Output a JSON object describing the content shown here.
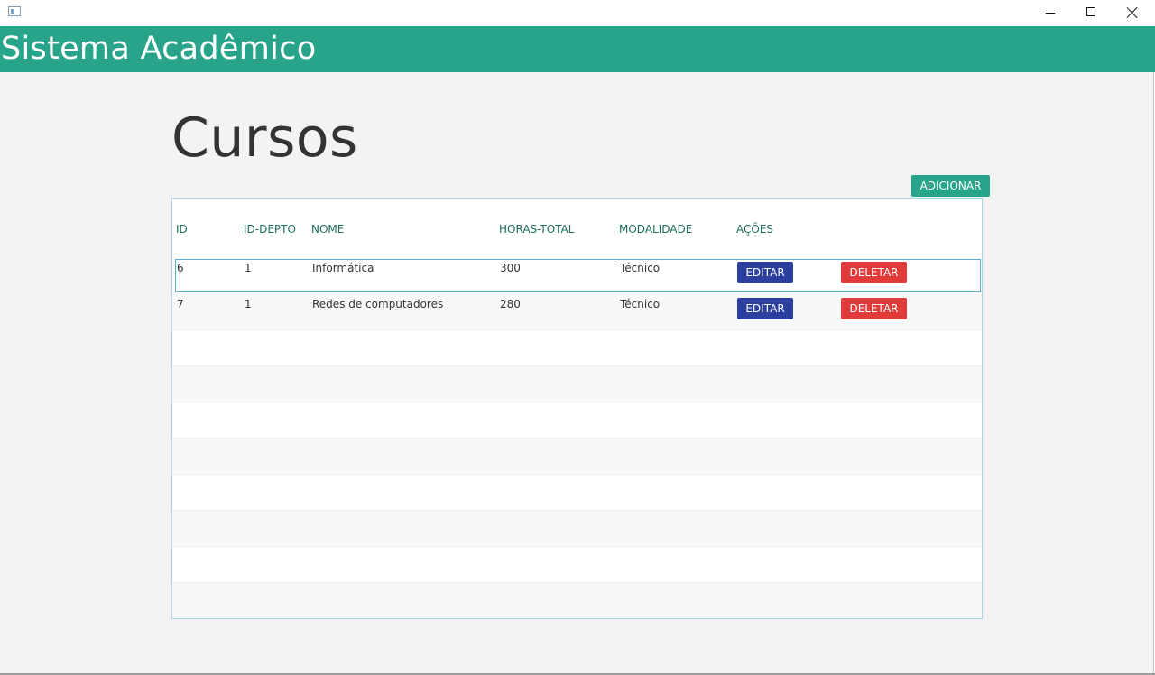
{
  "window": {
    "icons": [
      "app-icon",
      "minimize-icon",
      "maximize-icon",
      "close-icon"
    ]
  },
  "header": {
    "title": "Sistema Acadêmico"
  },
  "page": {
    "title": "Cursos",
    "add_label": "ADICIONAR"
  },
  "table": {
    "columns": [
      "ID",
      "ID-DEPTO",
      "NOME",
      "HORAS-TOTAL",
      "MODALIDADE",
      "AÇÕES"
    ],
    "rows": [
      {
        "id": "6",
        "id_depto": "1",
        "nome": "Informática",
        "horas_total": "300",
        "modalidade": "Técnico",
        "edit_label": "EDITAR",
        "delete_label": "DELETAR"
      },
      {
        "id": "7",
        "id_depto": "1",
        "nome": "Redes de computadores",
        "horas_total": "280",
        "modalidade": "Técnico",
        "edit_label": "EDITAR",
        "delete_label": "DELETAR"
      }
    ],
    "selected_row": 0
  },
  "colors": {
    "accent": "#27a489",
    "edit": "#2b3f9e",
    "delete": "#e03a3a",
    "header_text": "#1d6e5c"
  }
}
